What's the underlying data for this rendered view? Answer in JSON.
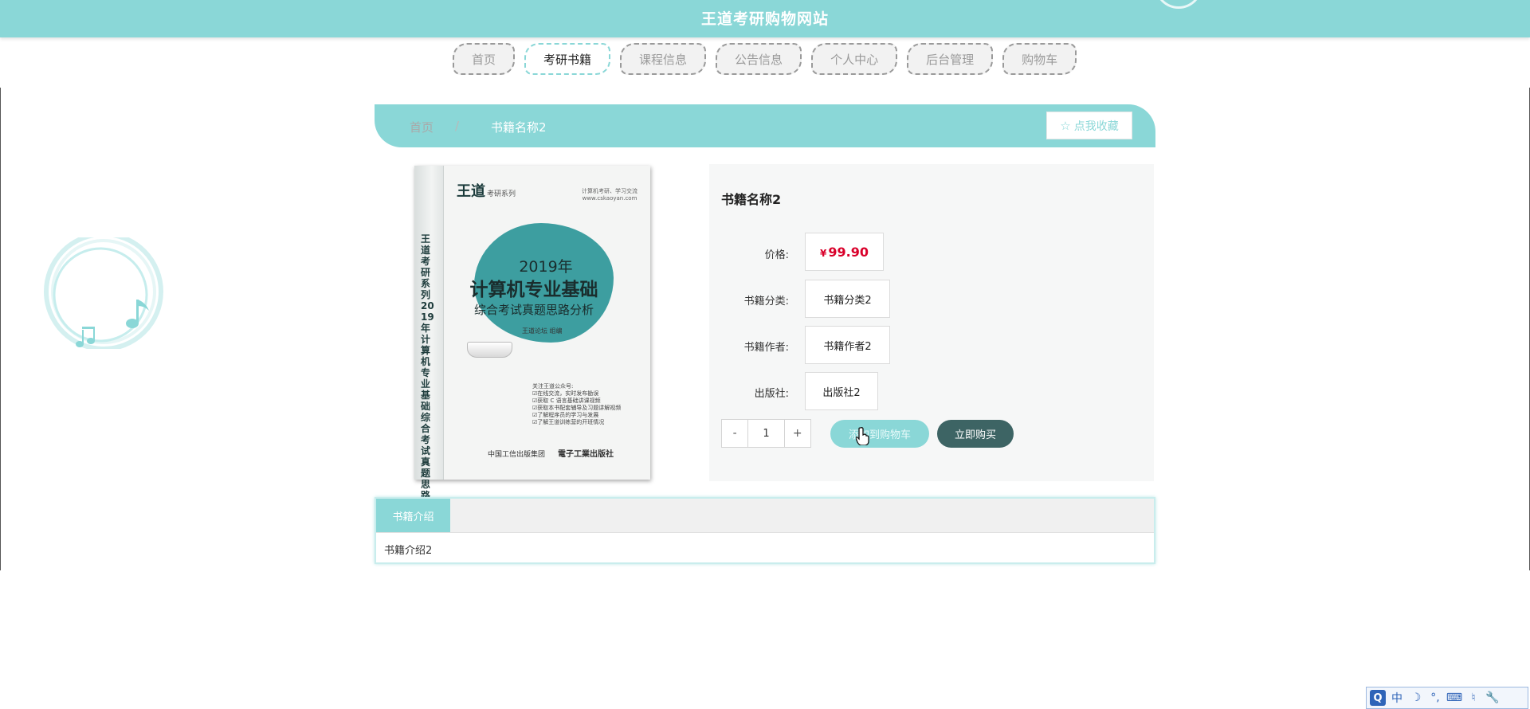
{
  "site": {
    "title": "王道考研购物网站"
  },
  "nav": {
    "items": [
      {
        "label": "首页"
      },
      {
        "label": "考研书籍"
      },
      {
        "label": "课程信息"
      },
      {
        "label": "公告信息"
      },
      {
        "label": "个人中心"
      },
      {
        "label": "后台管理"
      },
      {
        "label": "购物车"
      }
    ],
    "active_index": 1
  },
  "breadcrumb": {
    "home": "首页",
    "separator": "/",
    "current": "书籍名称2"
  },
  "favorite": {
    "label": "点我收藏",
    "icon": "star-outline-icon"
  },
  "book_cover": {
    "brand": "王道",
    "series": "考研系列",
    "tagline": "计算机考研、学习交流 www.cskaoyan.com",
    "year": "2019年",
    "main_title": "计算机专业基础",
    "subtitle": "综合考试真题思路分析",
    "editor": "王道论坛 组编",
    "notes": [
      "关注王道公众号:",
      "☑在线交流，实时发布勘误",
      "☑获取 C 语言基础讲课视频",
      "☑获取本书配套辅导及习题讲解视频",
      "☑了解程序员的学习与发展",
      "☑了解王道训练营的开班情况"
    ],
    "spine": "王道考研系列 2019年计算机专业基础综合考试真题思路分析",
    "publisher_1": "中国工信出版集团",
    "publisher_2": "電子工業出版社"
  },
  "product": {
    "title": "书籍名称2",
    "price_label": "价格:",
    "currency": "¥",
    "price": "99.90",
    "category_label": "书籍分类:",
    "category": "书籍分类2",
    "author_label": "书籍作者:",
    "author": "书籍作者2",
    "publisher_label": "出版社:",
    "publisher": "出版社2"
  },
  "quantity": {
    "minus": "-",
    "value": "1",
    "plus": "+"
  },
  "actions": {
    "add_to_cart": "添加到购物车",
    "buy_now": "立即购买"
  },
  "tabs": {
    "active": "书籍介绍",
    "content": "书籍介绍2"
  },
  "ime": {
    "items": [
      "Q",
      "中",
      "☽",
      "°,",
      "⌨",
      "♮",
      "🔧"
    ]
  },
  "colors": {
    "accent": "#8ad7d7",
    "dark": "#3d6464",
    "price": "#d9002a"
  }
}
